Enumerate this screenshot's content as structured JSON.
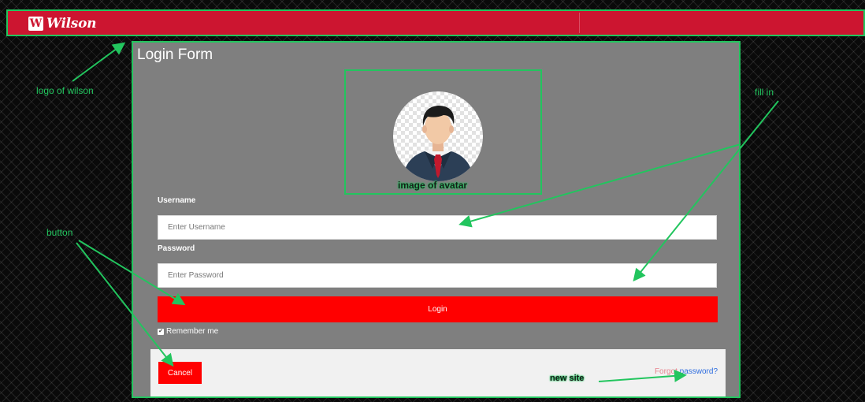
{
  "header": {
    "logo_mark": "W",
    "logo_text": "Wilson"
  },
  "form": {
    "title": "Login Form",
    "username_label": "Username",
    "username_placeholder": "Enter Username",
    "username_value": "",
    "password_label": "Password",
    "password_placeholder": "Enter Password",
    "password_value": "",
    "login_label": "Login",
    "remember_label": "Remember me",
    "remember_checked": true,
    "cancel_label": "Cancel",
    "forgot_word1": "Forgot",
    "forgot_word2": "password?"
  },
  "annotations": {
    "logo": "logo of wilson",
    "avatar": "image of avatar",
    "button": "button",
    "fill_in": "fill in",
    "new_site": "new site"
  },
  "colors": {
    "header_red": "#cc1530",
    "button_red": "#ff0000",
    "panel_gray": "#7f7f7f",
    "annotation_green": "#22c55e",
    "link_blue": "#2d6cdf"
  },
  "icons": {
    "logo": "wilson-w-logo-icon",
    "avatar": "user-avatar-icon",
    "checkbox": "checkbox-checked-icon"
  }
}
